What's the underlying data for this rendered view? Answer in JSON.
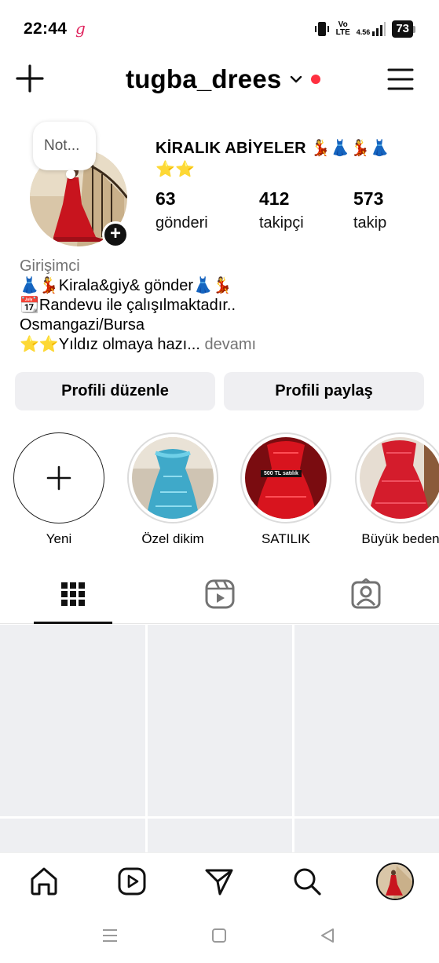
{
  "status_bar": {
    "time": "22:44",
    "app_icon": "g",
    "volte_top": "Vo",
    "volte_bottom": "LTE",
    "net_speed_top": "4.56",
    "battery": "73"
  },
  "header": {
    "username": "tugba_drees",
    "icons": [
      "plus-icon",
      "chevron-down-icon",
      "notification-dot",
      "menu-icon"
    ]
  },
  "profile": {
    "note": "Not...",
    "display_name": "KİRALIK ABİYELER 💃👗💃👗⭐⭐",
    "stats": [
      {
        "value": "63",
        "label": "gönderi"
      },
      {
        "value": "412",
        "label": "takipçi"
      },
      {
        "value": "573",
        "label": "takip"
      }
    ]
  },
  "bio": {
    "category": "Girişimci",
    "line1": "👗💃Kirala&giy& gönder👗💃",
    "line2": "📆Randevu ile çalışılmaktadır..",
    "line3": " Osmangazi/Bursa",
    "line4": "⭐⭐Yıldız olmaya hazı...",
    "more": " devamı"
  },
  "buttons": {
    "edit": "Profili düzenle",
    "share": "Profili paylaş"
  },
  "highlights": [
    {
      "label": "Yeni"
    },
    {
      "label": "Özel dikim"
    },
    {
      "label": "SATILIK",
      "badge": "500 TL satılık"
    },
    {
      "label": "Büyük beden"
    }
  ],
  "tabs": [
    "grid-icon",
    "reels-icon",
    "tagged-icon"
  ],
  "bottom_nav": [
    "home-icon",
    "reels-icon",
    "send-icon",
    "search-icon",
    "profile-avatar"
  ],
  "colors": {
    "notification_dot": "#ff3040",
    "button_bg": "#efeff2",
    "grid_placeholder": "#eeeff2",
    "muted_text": "#737373"
  }
}
